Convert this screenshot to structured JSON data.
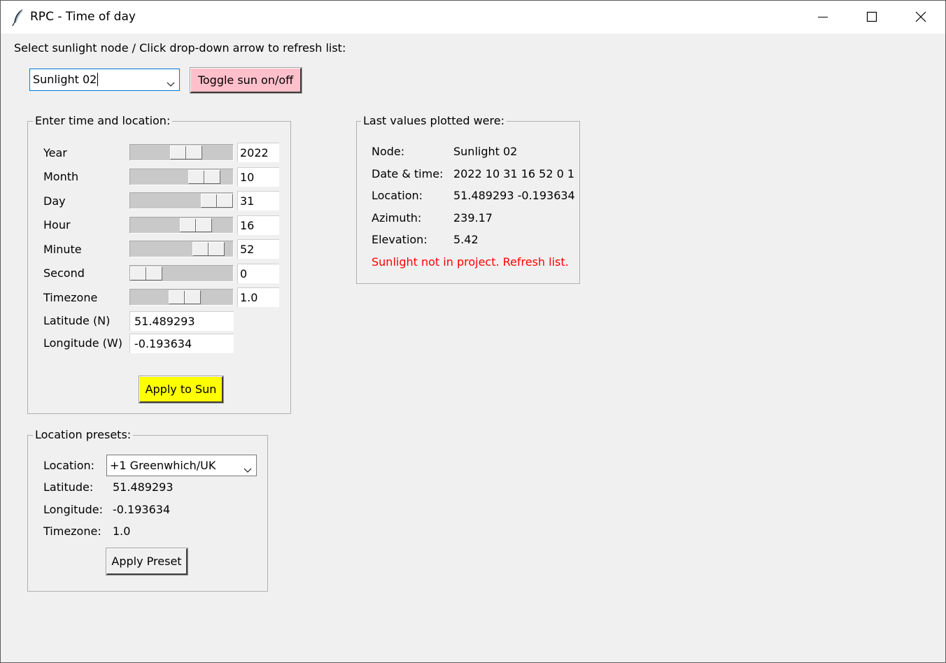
{
  "window": {
    "title": "RPC - Time of day"
  },
  "instruction": "Select sunlight node / Click drop-down arrow to refresh list:",
  "node_select": {
    "value": "Sunlight 02"
  },
  "toggle_button": "Toggle sun on/off",
  "time_location": {
    "label": "Enter time and location:",
    "sliders": [
      {
        "label": "Year",
        "value": "2022",
        "level": 0.56
      },
      {
        "label": "Month",
        "value": "10",
        "level": 0.82
      },
      {
        "label": "Day",
        "value": "31",
        "level": 1.0
      },
      {
        "label": "Hour",
        "value": "16",
        "level": 0.7
      },
      {
        "label": "Minute",
        "value": "52",
        "level": 0.88
      },
      {
        "label": "Second",
        "value": "0",
        "level": 0.0
      },
      {
        "label": "Timezone",
        "value": "1.0",
        "level": 0.54
      }
    ],
    "latitude": {
      "label": "Latitude (N)",
      "value": "51.489293"
    },
    "longitude": {
      "label": "Longitude (W)",
      "value": "-0.193634"
    },
    "apply_button": "Apply to Sun"
  },
  "last_values": {
    "label": "Last values plotted were:",
    "rows": [
      {
        "key": "Node:",
        "value": "Sunlight 02"
      },
      {
        "key": "Date & time:",
        "value": "2022 10 31 16 52 0 1"
      },
      {
        "key": "Location:",
        "value": "51.489293 -0.193634"
      },
      {
        "key": "Azimuth:",
        "value": "239.17"
      },
      {
        "key": "Elevation:",
        "value": "5.42"
      }
    ],
    "warning": "Sunlight not in project. Refresh list.",
    "warning_color": "#ff0000"
  },
  "presets": {
    "label": "Location presets:",
    "location_label": "Location:",
    "location_value": "+1 Greenwhich/UK",
    "latitude_label": "Latitude:",
    "latitude_value": "51.489293",
    "longitude_label": "Longitude:",
    "longitude_value": "-0.193634",
    "timezone_label": "Timezone:",
    "timezone_value": "1.0",
    "apply_button": "Apply Preset"
  },
  "colors": {
    "toggle_button_bg": "#ffc0cb",
    "apply_sun_bg": "#ffff00",
    "window_bg": "#f0f0f0"
  }
}
